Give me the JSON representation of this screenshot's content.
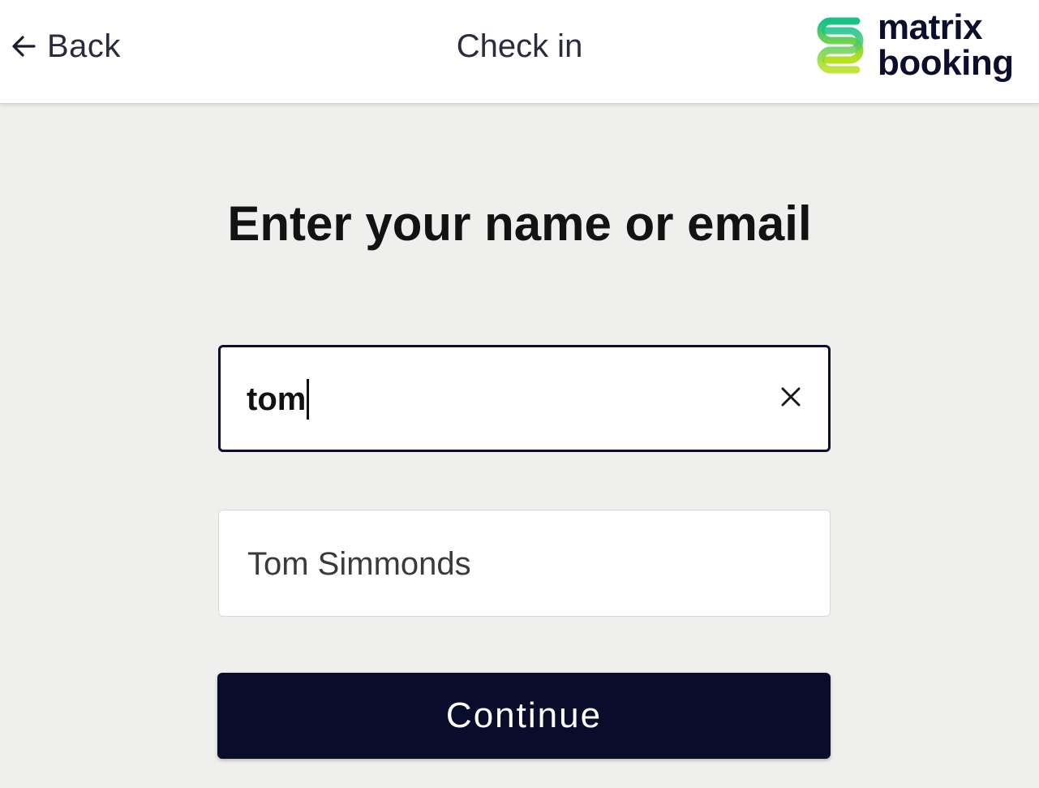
{
  "header": {
    "back_label": "Back",
    "title": "Check in",
    "logo": {
      "line1": "matrix",
      "line2": "booking",
      "brand_colors": [
        "#18c08a",
        "#b8e21c"
      ],
      "text_color": "#0c0f2c"
    }
  },
  "main": {
    "heading": "Enter your name or email",
    "search": {
      "value": "tom"
    },
    "suggestions": [
      {
        "label": "Tom Simmonds"
      }
    ],
    "continue_label": "Continue"
  },
  "icons": {
    "back": "arrow-left-icon",
    "clear": "close-icon",
    "logo": "matrix-booking-logo-icon"
  },
  "colors": {
    "primary": "#0a0c2b",
    "background": "#efefee",
    "surface": "#ffffff"
  }
}
